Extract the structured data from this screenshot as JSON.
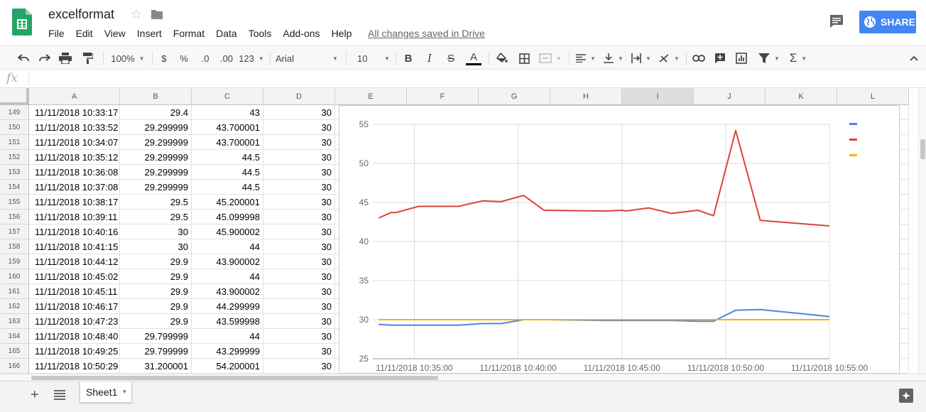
{
  "app": {
    "doc_title": "excelformat",
    "save_status": "All changes saved in Drive",
    "share_label": "SHARE"
  },
  "menu": [
    "File",
    "Edit",
    "View",
    "Insert",
    "Format",
    "Data",
    "Tools",
    "Add-ons",
    "Help"
  ],
  "toolbar": {
    "zoom": "100%",
    "currency": "$",
    "percent": "%",
    "decimal_less": ".0",
    "decimal_more": ".00",
    "more_formats": "123",
    "font": "Arial",
    "font_size": "10",
    "bold": "B",
    "italic": "I",
    "strikethrough": "S",
    "text_color": "A",
    "functions": "Σ"
  },
  "formula_bar": {
    "fx_label": "fx",
    "value": ""
  },
  "columns": [
    "A",
    "B",
    "C",
    "D",
    "E",
    "F",
    "G",
    "H",
    "I",
    "J",
    "K",
    "L"
  ],
  "selected_column": "I",
  "rows": [
    {
      "n": "149",
      "a": "11/11/2018 10:33:17",
      "b": "29.4",
      "c": "43",
      "d": "30"
    },
    {
      "n": "150",
      "a": "11/11/2018 10:33:52",
      "b": "29.299999",
      "c": "43.700001",
      "d": "30"
    },
    {
      "n": "151",
      "a": "11/11/2018 10:34:07",
      "b": "29.299999",
      "c": "43.700001",
      "d": "30"
    },
    {
      "n": "152",
      "a": "11/11/2018 10:35:12",
      "b": "29.299999",
      "c": "44.5",
      "d": "30"
    },
    {
      "n": "153",
      "a": "11/11/2018 10:36:08",
      "b": "29.299999",
      "c": "44.5",
      "d": "30"
    },
    {
      "n": "154",
      "a": "11/11/2018 10:37:08",
      "b": "29.299999",
      "c": "44.5",
      "d": "30"
    },
    {
      "n": "155",
      "a": "11/11/2018 10:38:17",
      "b": "29.5",
      "c": "45.200001",
      "d": "30"
    },
    {
      "n": "156",
      "a": "11/11/2018 10:39:11",
      "b": "29.5",
      "c": "45.099998",
      "d": "30"
    },
    {
      "n": "157",
      "a": "11/11/2018 10:40:16",
      "b": "30",
      "c": "45.900002",
      "d": "30"
    },
    {
      "n": "158",
      "a": "11/11/2018 10:41:15",
      "b": "30",
      "c": "44",
      "d": "30"
    },
    {
      "n": "159",
      "a": "11/11/2018 10:44:12",
      "b": "29.9",
      "c": "43.900002",
      "d": "30"
    },
    {
      "n": "160",
      "a": "11/11/2018 10:45:02",
      "b": "29.9",
      "c": "44",
      "d": "30"
    },
    {
      "n": "161",
      "a": "11/11/2018 10:45:11",
      "b": "29.9",
      "c": "43.900002",
      "d": "30"
    },
    {
      "n": "162",
      "a": "11/11/2018 10:46:17",
      "b": "29.9",
      "c": "44.299999",
      "d": "30"
    },
    {
      "n": "163",
      "a": "11/11/2018 10:47:23",
      "b": "29.9",
      "c": "43.599998",
      "d": "30"
    },
    {
      "n": "164",
      "a": "11/11/2018 10:48:40",
      "b": "29.799999",
      "c": "44",
      "d": "30"
    },
    {
      "n": "165",
      "a": "11/11/2018 10:49:25",
      "b": "29.799999",
      "c": "43.299999",
      "d": "30"
    },
    {
      "n": "166",
      "a": "11/11/2018 10:50:29",
      "b": "31.200001",
      "c": "54.200001",
      "d": "30"
    }
  ],
  "sheet_tab": "Sheet1",
  "chart_data": {
    "type": "line",
    "title": "",
    "xlabel": "",
    "ylabel": "",
    "ylim": [
      25,
      55
    ],
    "yticks": [
      25,
      30,
      35,
      40,
      45,
      50,
      55
    ],
    "xlim": [
      "10:33:00",
      "10:55:00"
    ],
    "xtick_labels": [
      "11/11/2018 10:35:00",
      "11/11/2018 10:40:00",
      "11/11/2018 10:45:00",
      "11/11/2018 10:50:00",
      "11/11/2018 10:55:00"
    ],
    "xtick_times": [
      "10:35:00",
      "10:40:00",
      "10:45:00",
      "10:50:00",
      "10:55:00"
    ],
    "grid": true,
    "legend_position": "right",
    "x": [
      "10:33:17",
      "10:33:52",
      "10:34:07",
      "10:35:12",
      "10:36:08",
      "10:37:08",
      "10:38:17",
      "10:39:11",
      "10:40:16",
      "10:41:15",
      "10:44:12",
      "10:45:02",
      "10:45:11",
      "10:46:17",
      "10:47:23",
      "10:48:40",
      "10:49:25",
      "10:50:29",
      "10:51:40",
      "10:55:00"
    ],
    "series": [
      {
        "color": "#4a86e8",
        "values": [
          29.4,
          29.3,
          29.3,
          29.3,
          29.3,
          29.3,
          29.5,
          29.5,
          30,
          30,
          29.9,
          29.9,
          29.9,
          29.9,
          29.9,
          29.8,
          29.8,
          31.2,
          31.3,
          30.4
        ]
      },
      {
        "color": "#db4437",
        "values": [
          43,
          43.7,
          43.7,
          44.5,
          44.5,
          44.5,
          45.2,
          45.1,
          45.9,
          44,
          43.9,
          44,
          43.9,
          44.3,
          43.6,
          44,
          43.3,
          54.2,
          42.7,
          42
        ]
      },
      {
        "color": "#f4b400",
        "values": [
          30,
          30,
          30,
          30,
          30,
          30,
          30,
          30,
          30,
          30,
          30,
          30,
          30,
          30,
          30,
          30,
          30,
          30,
          30,
          30
        ]
      }
    ]
  }
}
